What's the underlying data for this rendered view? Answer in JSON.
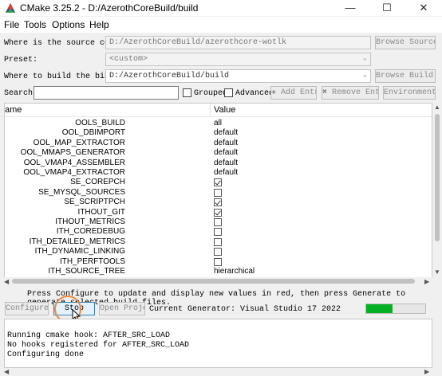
{
  "window": {
    "title": "CMake 3.25.2 - D:/AzerothCoreBuild/build",
    "controls": {
      "minimize": "—",
      "maximize": "☐",
      "close": "✕"
    }
  },
  "menu": [
    "File",
    "Tools",
    "Options",
    "Help"
  ],
  "source": {
    "label": "Where is the source code:",
    "value": "D:/AzerothCoreBuild/azerothcore-wotlk",
    "browse": "Browse Source..."
  },
  "preset": {
    "label": "Preset:",
    "value": "<custom>"
  },
  "build": {
    "label": "Where to build the binaries:",
    "value": "D:/AzerothCoreBuild/build",
    "browse": "Browse Build..."
  },
  "search": {
    "label": "Search:",
    "value": ""
  },
  "options": {
    "grouped": "Grouped",
    "advanced": "Advanced"
  },
  "toolbar": {
    "add_entry": "Add Entry",
    "remove_entry": "Remove Entry",
    "environment": "Environment..."
  },
  "table": {
    "headers": {
      "name": "ame",
      "value": "Value"
    },
    "rows": [
      {
        "name": "OOLS_BUILD",
        "value": "all"
      },
      {
        "name": "OOL_DBIMPORT",
        "value": "default"
      },
      {
        "name": "OOL_MAP_EXTRACTOR",
        "value": "default"
      },
      {
        "name": "OOL_MMAPS_GENERATOR",
        "value": "default"
      },
      {
        "name": "OOL_VMAP4_ASSEMBLER",
        "value": "default"
      },
      {
        "name": "OOL_VMAP4_EXTRACTOR",
        "value": "default"
      },
      {
        "name": "SE_COREPCH",
        "checked": true
      },
      {
        "name": "SE_MYSQL_SOURCES",
        "checked": false
      },
      {
        "name": "SE_SCRIPTPCH",
        "checked": true
      },
      {
        "name": "ITHOUT_GIT",
        "checked": true
      },
      {
        "name": "ITHOUT_METRICS",
        "checked": false
      },
      {
        "name": "ITH_COREDEBUG",
        "checked": false
      },
      {
        "name": "ITH_DETAILED_METRICS",
        "checked": false
      },
      {
        "name": "ITH_DYNAMIC_LINKING",
        "checked": false
      },
      {
        "name": "ITH_PERFTOOLS",
        "checked": false
      },
      {
        "name": "ITH_SOURCE_TREE",
        "value": "hierarchical"
      }
    ]
  },
  "status_message": "Press Configure to update and display new values in red, then press Generate to generate selected build files.",
  "actions": {
    "configure": "Configure",
    "stop": "Stop",
    "open_project": "Open Project"
  },
  "generator": "Current Generator: Visual Studio 17 2022",
  "progress": {
    "fraction": 0.45,
    "color": "#06b025"
  },
  "output": [
    "Running cmake hook: AFTER_SRC_LOAD",
    "No hooks registered for AFTER_SRC_LOAD",
    "Configuring done"
  ]
}
